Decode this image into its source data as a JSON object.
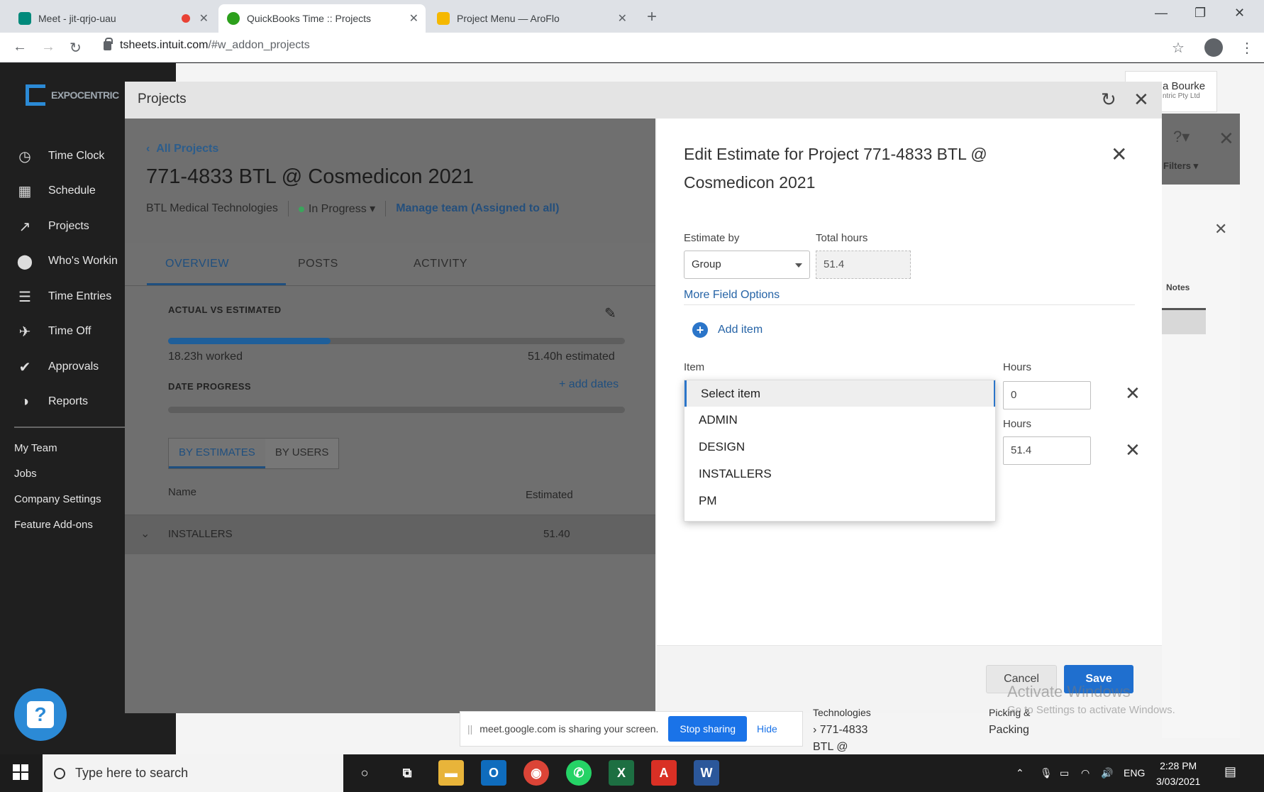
{
  "browser": {
    "tabs": [
      {
        "title": "Meet - jit-qrjo-uau",
        "favicon_color": "#00897b"
      },
      {
        "title": "QuickBooks Time :: Projects",
        "favicon_color": "#2ca01c"
      },
      {
        "title": "Project Menu — AroFlo",
        "favicon_color": "#f5b800"
      }
    ],
    "url_host": "tsheets.intuit.com",
    "url_path": "/#w_addon_projects"
  },
  "sidebar": {
    "brand": "EXPOCENTRIC",
    "items": [
      {
        "label": "Time Clock",
        "icon": "clock-icon"
      },
      {
        "label": "Schedule",
        "icon": "calendar-icon"
      },
      {
        "label": "Projects",
        "icon": "chart-line-icon"
      },
      {
        "label": "Who's Workin",
        "icon": "map-pin-icon"
      },
      {
        "label": "Time Entries",
        "icon": "list-clock-icon"
      },
      {
        "label": "Time Off",
        "icon": "plane-icon"
      },
      {
        "label": "Approvals",
        "icon": "double-check-icon"
      },
      {
        "label": "Reports",
        "icon": "pie-chart-icon"
      }
    ],
    "links": [
      "My Team",
      "Jobs",
      "Company Settings",
      "Feature Add-ons"
    ]
  },
  "header_user": {
    "name": "a Bourke",
    "org": "ntric Pty Ltd"
  },
  "projects_modal": {
    "title": "Projects",
    "breadcrumb": "All Projects",
    "project_title": "771-4833 BTL @ Cosmedicon 2021",
    "client": "BTL Medical Technologies",
    "status": "In Progress",
    "manage_team": "Manage team (Assigned to all)",
    "tabs": [
      "OVERVIEW",
      "POSTS",
      "ACTIVITY"
    ],
    "actual_vs_estimated": "ACTUAL VS ESTIMATED",
    "worked": "18.23h worked",
    "estimated": "51.40h estimated",
    "worked_fraction": 0.355,
    "date_progress": "DATE PROGRESS",
    "add_dates": "+ add dates",
    "segments": [
      "BY ESTIMATES",
      "BY USERS"
    ],
    "col_name": "Name",
    "col_estimated": "Estimated",
    "row": {
      "name": "INSTALLERS",
      "value": "51.40"
    }
  },
  "edit_estimate": {
    "title": "Edit Estimate for Project 771-4833 BTL @ Cosmedicon 2021",
    "estimate_by_label": "Estimate by",
    "estimate_by_value": "Group",
    "total_hours_label": "Total hours",
    "total_hours_value": "51.4",
    "more_options": "More Field Options",
    "add_item": "Add item",
    "item_label": "Item",
    "hours_label": "Hours",
    "dropdown_options": [
      "Select item",
      "ADMIN",
      "DESIGN",
      "INSTALLERS",
      "PM"
    ],
    "hours_row1": "0",
    "hours_row2": "51.4",
    "cancel": "Cancel",
    "save": "Save"
  },
  "right_panel": {
    "filters": "Filters",
    "notes": "Notes"
  },
  "sharing_bar": {
    "message": "meet.google.com is sharing your screen.",
    "stop": "Stop sharing",
    "hide": "Hide"
  },
  "behind_text": {
    "line1": "Technologies",
    "line2": "› 771-4833",
    "line3": "BTL @",
    "col2a": "Picking &",
    "col2b": "Packing"
  },
  "watermark": {
    "title": "Activate Windows",
    "subtitle": "Go to Settings to activate Windows."
  },
  "taskbar": {
    "search_placeholder": "Type here to search",
    "lang": "ENG",
    "time": "2:28 PM",
    "date": "3/03/2021"
  }
}
